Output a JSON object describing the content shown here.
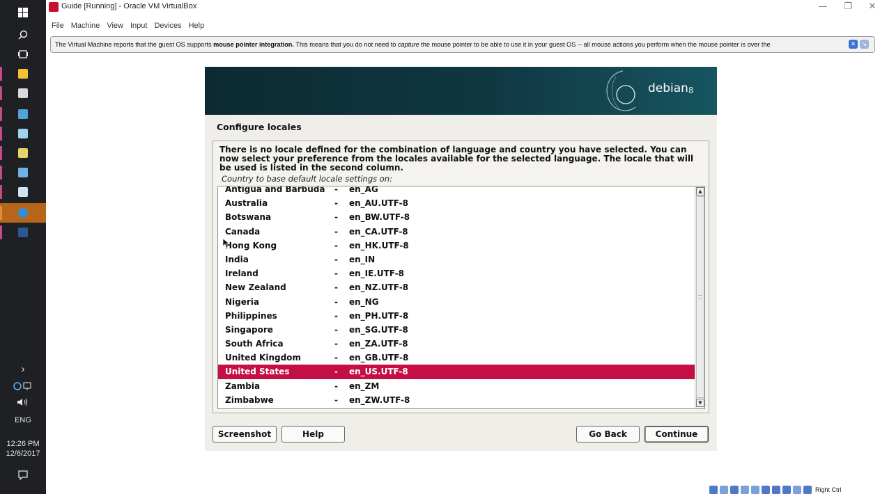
{
  "taskbar": {
    "clock_time": "12:26 PM",
    "clock_date": "12/6/2017",
    "language": "ENG",
    "chevron": "›"
  },
  "window": {
    "title": "Guide [Running] - Oracle VM VirtualBox",
    "menu": [
      "File",
      "Machine",
      "View",
      "Input",
      "Devices",
      "Help"
    ]
  },
  "notice": {
    "part1": "The Virtual Machine reports that the guest OS supports ",
    "bold": "mouse pointer integration.",
    "part2": " This means that you do not need to ",
    "italic": "capture",
    "part3": " the mouse pointer to be able to use it in your guest OS -- all mouse actions you perform when the mouse pointer is over the"
  },
  "installer": {
    "brand": "debian",
    "brand_version": "8",
    "page_title": "Configure locales",
    "description": "There is no locale defined for the combination of language and country you have selected. You can now select your preference from the locales available for the selected language. The locale that will be used is listed in the second column.",
    "list_label": "Country to base default locale settings on:",
    "rows": [
      {
        "country": "Antigua and Barbuda",
        "locale": "en_AG"
      },
      {
        "country": "Australia",
        "locale": "en_AU.UTF-8"
      },
      {
        "country": "Botswana",
        "locale": "en_BW.UTF-8"
      },
      {
        "country": "Canada",
        "locale": "en_CA.UTF-8"
      },
      {
        "country": "Hong Kong",
        "locale": "en_HK.UTF-8"
      },
      {
        "country": "India",
        "locale": "en_IN"
      },
      {
        "country": "Ireland",
        "locale": "en_IE.UTF-8"
      },
      {
        "country": "New Zealand",
        "locale": "en_NZ.UTF-8"
      },
      {
        "country": "Nigeria",
        "locale": "en_NG"
      },
      {
        "country": "Philippines",
        "locale": "en_PH.UTF-8"
      },
      {
        "country": "Singapore",
        "locale": "en_SG.UTF-8"
      },
      {
        "country": "South Africa",
        "locale": "en_ZA.UTF-8"
      },
      {
        "country": "United Kingdom",
        "locale": "en_GB.UTF-8"
      },
      {
        "country": "United States",
        "locale": "en_US.UTF-8"
      },
      {
        "country": "Zambia",
        "locale": "en_ZM"
      },
      {
        "country": "Zimbabwe",
        "locale": "en_ZW.UTF-8"
      }
    ],
    "separator": "-",
    "selected_country": "United States",
    "selection_color": "#c40f45",
    "buttons": {
      "screenshot": "Screenshot",
      "help": "Help",
      "go_back": "Go Back",
      "continue": "Continue"
    }
  },
  "statusbar": {
    "host_key": "Right Ctrl"
  }
}
